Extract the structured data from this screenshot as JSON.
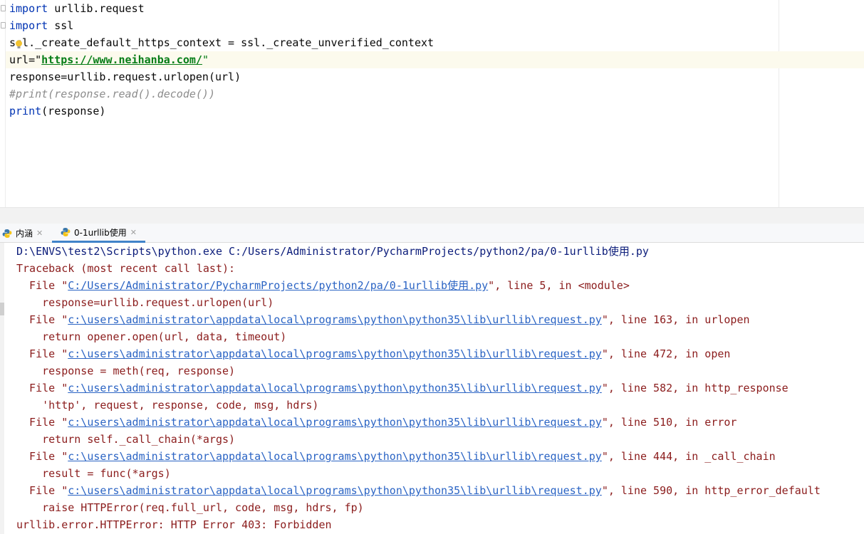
{
  "editor": {
    "lines": {
      "l1": {
        "kw": "import",
        "rest": " urllib.request"
      },
      "l2": {
        "kw": "import",
        "rest": " ssl"
      },
      "l3": {
        "text": "ssl._create_default_https_context = ssl._create_unverified_context"
      },
      "l4": {
        "pre": "url=\"",
        "url": "https://www.neihanba.com/",
        "post": "\""
      },
      "l5": {
        "text": "response=urllib.request.urlopen(url)"
      },
      "l6": {
        "text": "#print(response.read().decode())"
      },
      "l7": {
        "kw": "print",
        "rest": "(response)"
      }
    }
  },
  "tabs": [
    {
      "label": "内涵",
      "icon": "python-icon",
      "active": false
    },
    {
      "label": "0-1urllib使用",
      "icon": "python-icon",
      "active": true
    }
  ],
  "console": {
    "command": "D:\\ENVS\\test2\\Scripts\\python.exe C:/Users/Administrator/PycharmProjects/python2/pa/0-1urllib使用.py",
    "traceback_header": "Traceback (most recent call last):",
    "frames": [
      {
        "file_prefix": "  File \"",
        "file": "C:/Users/Administrator/PycharmProjects/python2/pa/0-1urllib使用.py",
        "suffix": "\", line 5, in <module>",
        "code": "    response=urllib.request.urlopen(url)"
      },
      {
        "file_prefix": "  File \"",
        "file": "c:\\users\\administrator\\appdata\\local\\programs\\python\\python35\\lib\\urllib\\request.py",
        "suffix": "\", line 163, in urlopen",
        "code": "    return opener.open(url, data, timeout)"
      },
      {
        "file_prefix": "  File \"",
        "file": "c:\\users\\administrator\\appdata\\local\\programs\\python\\python35\\lib\\urllib\\request.py",
        "suffix": "\", line 472, in open",
        "code": "    response = meth(req, response)"
      },
      {
        "file_prefix": "  File \"",
        "file": "c:\\users\\administrator\\appdata\\local\\programs\\python\\python35\\lib\\urllib\\request.py",
        "suffix": "\", line 582, in http_response",
        "code": "    'http', request, response, code, msg, hdrs)"
      },
      {
        "file_prefix": "  File \"",
        "file": "c:\\users\\administrator\\appdata\\local\\programs\\python\\python35\\lib\\urllib\\request.py",
        "suffix": "\", line 510, in error",
        "code": "    return self._call_chain(*args)"
      },
      {
        "file_prefix": "  File \"",
        "file": "c:\\users\\administrator\\appdata\\local\\programs\\python\\python35\\lib\\urllib\\request.py",
        "suffix": "\", line 444, in _call_chain",
        "code": "    result = func(*args)"
      },
      {
        "file_prefix": "  File \"",
        "file": "c:\\users\\administrator\\appdata\\local\\programs\\python\\python35\\lib\\urllib\\request.py",
        "suffix": "\", line 590, in http_error_default",
        "code": "    raise HTTPError(req.full_url, code, msg, hdrs, fp)"
      }
    ],
    "error": "urllib.error.HTTPError: HTTP Error 403: Forbidden"
  },
  "colors": {
    "keyword": "#0033b3",
    "string": "#067d17",
    "error": "#8b1c1c",
    "link": "#2b64c4",
    "tab_accent": "#4083c9"
  }
}
